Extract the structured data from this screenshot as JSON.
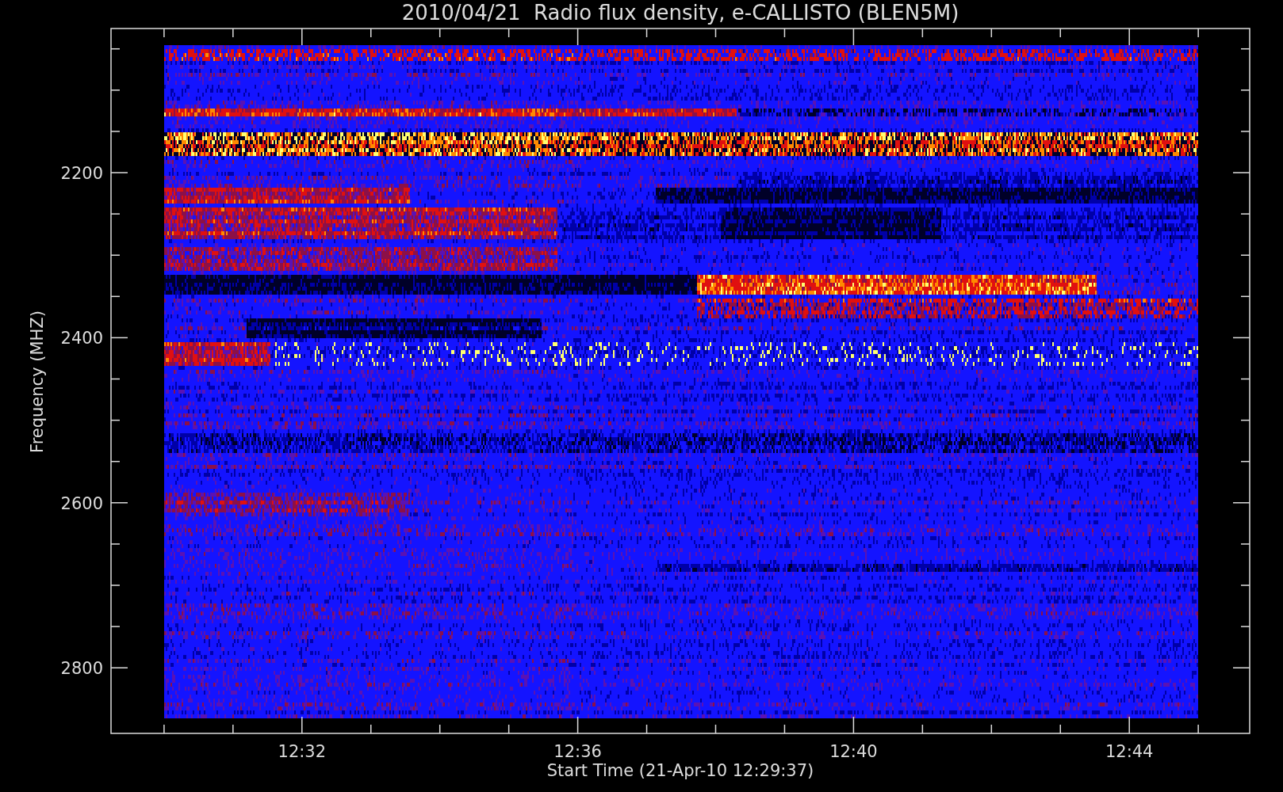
{
  "plot": {
    "title": "2010/04/21  Radio flux density, e-CALLISTO (BLEN5M)",
    "ylabel": "Frequency (MHZ)",
    "xlabel": "Start Time (21-Apr-10 12:29:37)",
    "yticks": [
      "2200",
      "2400",
      "2600",
      "2800"
    ],
    "xticks": [
      "12:32",
      "12:36",
      "12:40",
      "12:44"
    ]
  }
}
